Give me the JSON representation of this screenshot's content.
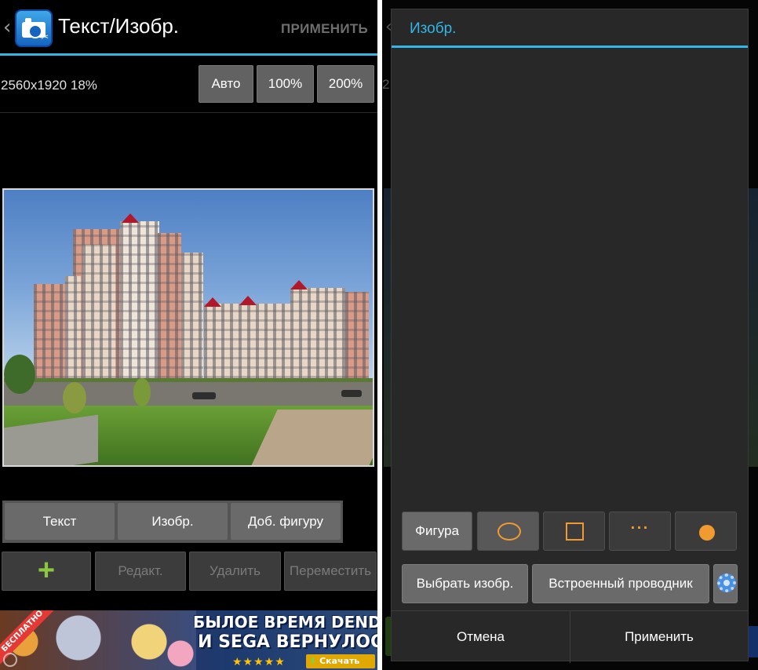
{
  "left": {
    "actionbar": {
      "title": "Текст/Изобр.",
      "apply_label": "ПРИМЕНИТЬ"
    },
    "infobar": {
      "resolution_text": "2560x1920 18%",
      "zoom_buttons": [
        "Авто",
        "100%",
        "200%"
      ]
    },
    "tabs": [
      "Текст",
      "Изобр.",
      "Доб. фигуру"
    ],
    "actions": {
      "add_label": "+",
      "edit_label": "Редакт.",
      "delete_label": "Удалить",
      "move_label": "Переместить"
    },
    "ad": {
      "ribbon": "БЕСПЛАТНО",
      "line1": "БЫЛОЕ ВРЕМЯ DENDY",
      "line2": "И SEGA ВЕРНУЛОСЬ!",
      "stars": "★★★★★",
      "download_label": "Скачать"
    }
  },
  "right": {
    "dimmed": {
      "partial_text": "2"
    },
    "dialog": {
      "title": "Изобр.",
      "shape_label": "Фигура",
      "shape_options": [
        "ellipse-outline",
        "square-outline",
        "dots",
        "filled-circle"
      ],
      "selected_shape": "ellipse-outline",
      "pick_image_label": "Выбрать изобр.",
      "builtin_browser_label": "Встроенный проводник",
      "cancel_label": "Отмена",
      "apply_label": "Применить"
    }
  },
  "colors": {
    "accent": "#33b5e5",
    "shape_orange": "#f19a2f",
    "add_green": "#8dc63f"
  }
}
